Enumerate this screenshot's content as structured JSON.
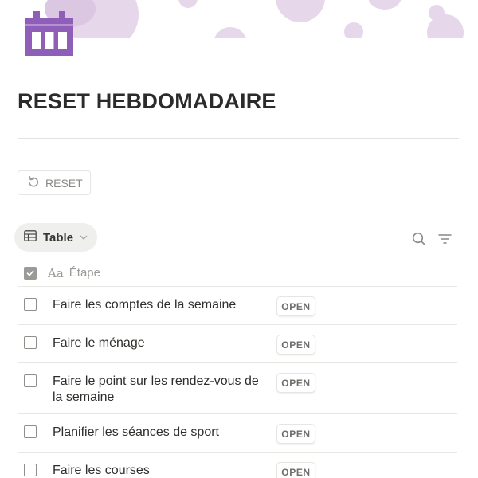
{
  "page": {
    "title": "RESET HEBDOMADAIRE",
    "icon": "calendar-icon",
    "accent_color": "#8e5eb8",
    "cover_color": "#e6d7ea"
  },
  "toolbar": {
    "reset_label": "RESET",
    "reset_icon": "rotate-left-icon"
  },
  "view": {
    "tab_label": "Table",
    "tab_icon": "table-icon",
    "search_icon": "search-icon",
    "filter_icon": "filter-icon"
  },
  "table": {
    "column_header": "Étape",
    "column_type_glyph": "Aa",
    "rows": [
      {
        "label": "Faire les comptes de la semaine",
        "action": "OPEN",
        "checked": false
      },
      {
        "label": "Faire le ménage",
        "action": "OPEN",
        "checked": false
      },
      {
        "label": "Faire le point sur les rendez-vous de la semaine",
        "action": "OPEN",
        "checked": false
      },
      {
        "label": "Planifier les séances de sport",
        "action": "OPEN",
        "checked": false
      },
      {
        "label": "Faire les courses",
        "action": "OPEN",
        "checked": false
      }
    ]
  }
}
